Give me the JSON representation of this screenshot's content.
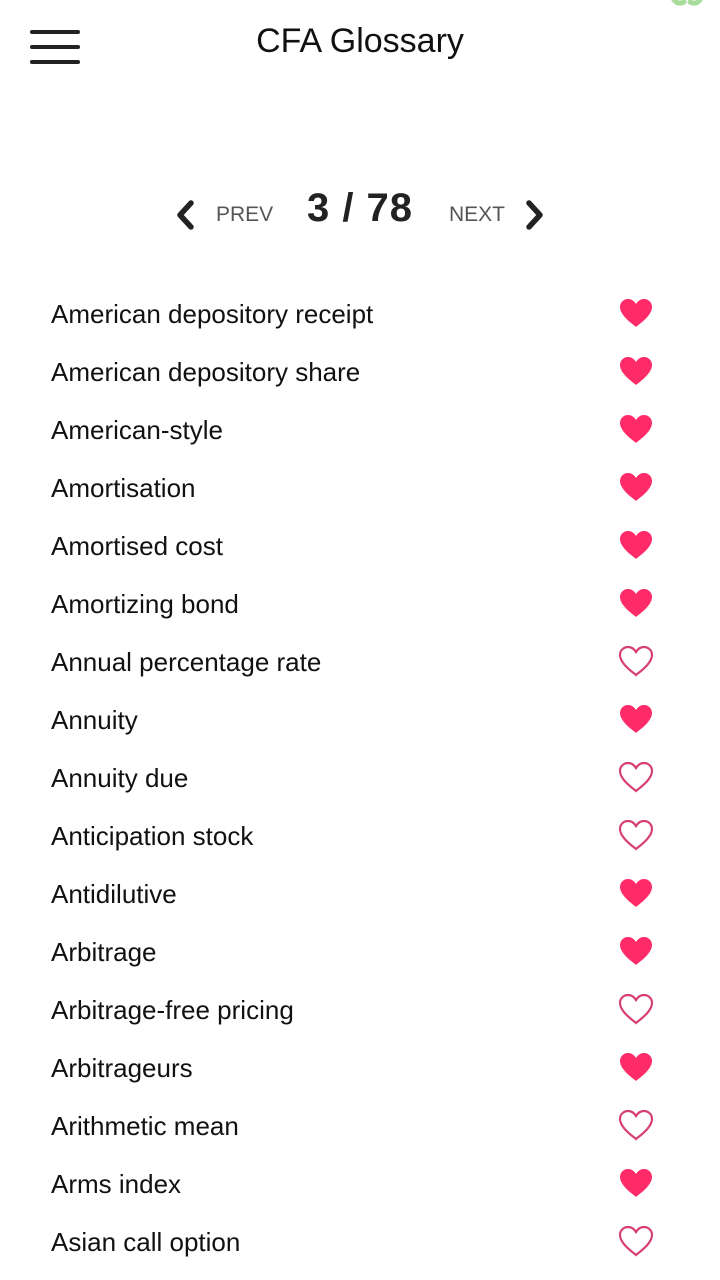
{
  "header": {
    "title": "CFA Glossary",
    "menu_icon": "hamburger-menu-icon"
  },
  "pager": {
    "prev_label": "PREV",
    "next_label": "NEXT",
    "current_page": 3,
    "total_pages": 78,
    "page_display": "3 / 78"
  },
  "colors": {
    "heart": "#ff2a68",
    "heart_outline": "#d64070",
    "text": "#111111",
    "pager_label": "#555555"
  },
  "terms": [
    {
      "label": "American depository receipt",
      "favorite": true
    },
    {
      "label": "American depository share",
      "favorite": true
    },
    {
      "label": "American-style",
      "favorite": true
    },
    {
      "label": "Amortisation",
      "favorite": true
    },
    {
      "label": "Amortised cost",
      "favorite": true
    },
    {
      "label": "Amortizing bond",
      "favorite": true
    },
    {
      "label": "Annual percentage rate",
      "favorite": false
    },
    {
      "label": "Annuity",
      "favorite": true
    },
    {
      "label": "Annuity due",
      "favorite": false
    },
    {
      "label": "Anticipation stock",
      "favorite": false
    },
    {
      "label": "Antidilutive",
      "favorite": true
    },
    {
      "label": "Arbitrage",
      "favorite": true
    },
    {
      "label": "Arbitrage-free pricing",
      "favorite": false
    },
    {
      "label": "Arbitrageurs",
      "favorite": true
    },
    {
      "label": "Arithmetic mean",
      "favorite": false
    },
    {
      "label": "Arms index",
      "favorite": true
    },
    {
      "label": "Asian call option",
      "favorite": false
    }
  ]
}
